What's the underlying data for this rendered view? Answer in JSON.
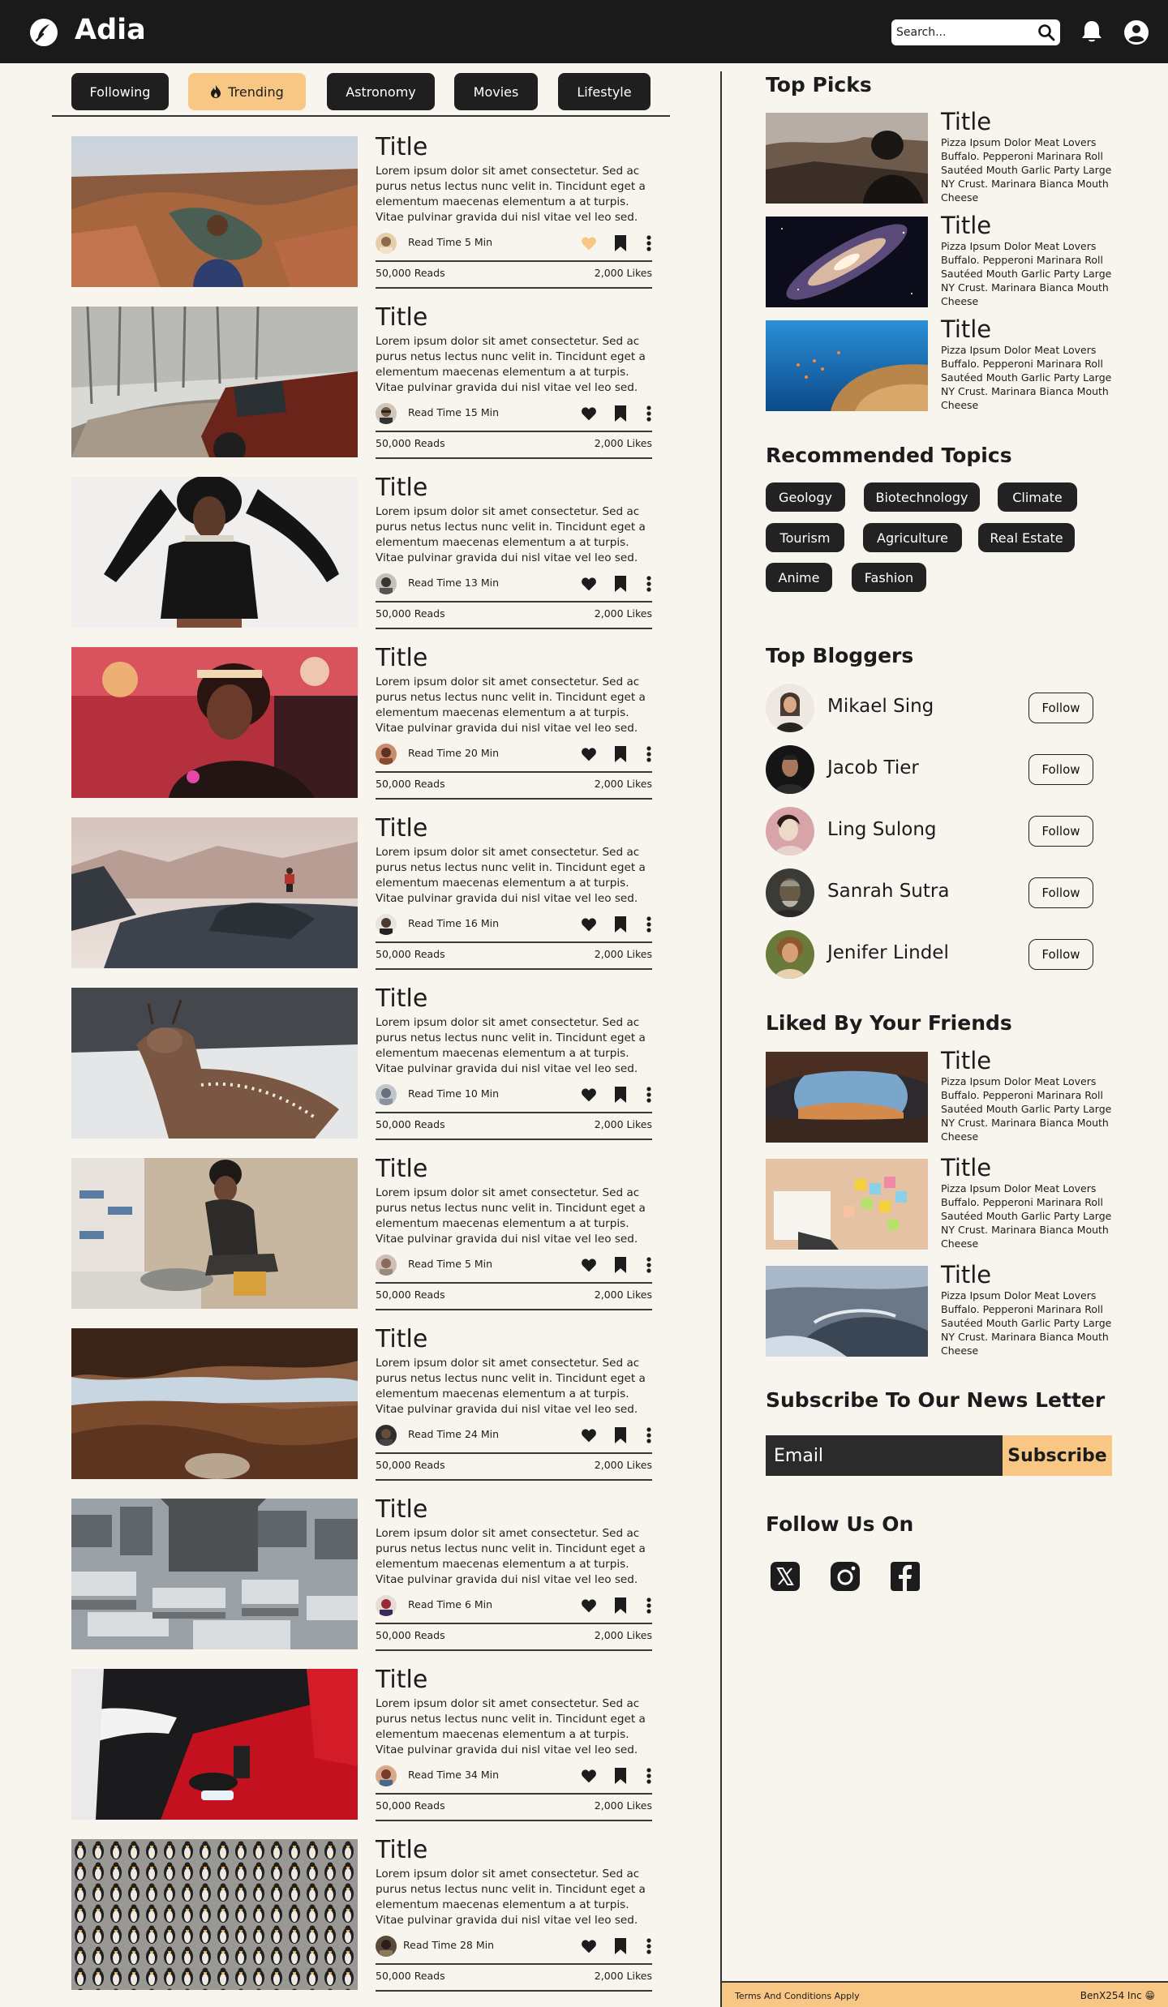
{
  "header": {
    "brand": "Adia",
    "search_placeholder": "Search...",
    "logo_icon": "feather-logo-icon",
    "search_icon": "search-icon",
    "bell_icon": "bell-icon",
    "user_icon": "user-circle-icon"
  },
  "tabs": [
    {
      "label": "Following",
      "active": false
    },
    {
      "label": "Trending",
      "active": true,
      "icon": "flame-icon"
    },
    {
      "label": "Astronomy",
      "active": false
    },
    {
      "label": "Movies",
      "active": false
    },
    {
      "label": "Lifestyle",
      "active": false
    }
  ],
  "posts": [
    {
      "title": "Title",
      "body": "Lorem ipsum dolor sit amet consectetur. Sed ac purus netus lectus nunc velit in. Tincidunt eget a elementum maecenas elementum a at turpis. Vitae pulvinar gravida dui nisl vitae vel leo sed.",
      "read_time": "Read Time 5 Min",
      "reads": "50,000 Reads",
      "likes": "2,000 Likes",
      "liked": true
    },
    {
      "title": "Title",
      "body": "Lorem ipsum dolor sit amet consectetur. Sed ac purus netus lectus nunc velit in. Tincidunt eget a elementum maecenas elementum a at turpis. Vitae pulvinar gravida dui nisl vitae vel leo sed.",
      "read_time": "Read Time 15 Min",
      "reads": "50,000 Reads",
      "likes": "2,000 Likes",
      "liked": false
    },
    {
      "title": "Title",
      "body": "Lorem ipsum dolor sit amet consectetur. Sed ac purus netus lectus nunc velit in. Tincidunt eget a elementum maecenas elementum a at turpis. Vitae pulvinar gravida dui nisl vitae vel leo sed.",
      "read_time": "Read Time 13 Min",
      "reads": "50,000 Reads",
      "likes": "2,000 Likes",
      "liked": false
    },
    {
      "title": "Title",
      "body": "Lorem ipsum dolor sit amet consectetur. Sed ac purus netus lectus nunc velit in. Tincidunt eget a elementum maecenas elementum a at turpis. Vitae pulvinar gravida dui nisl vitae vel leo sed.",
      "read_time": "Read Time 20 Min",
      "reads": "50,000 Reads",
      "likes": "2,000 Likes",
      "liked": false
    },
    {
      "title": "Title",
      "body": "Lorem ipsum dolor sit amet consectetur. Sed ac purus netus lectus nunc velit in. Tincidunt eget a elementum maecenas elementum a at turpis. Vitae pulvinar gravida dui nisl vitae vel leo sed.",
      "read_time": "Read Time 16 Min",
      "reads": "50,000 Reads",
      "likes": "2,000 Likes",
      "liked": false
    },
    {
      "title": "Title",
      "body": "Lorem ipsum dolor sit amet consectetur. Sed ac purus netus lectus nunc velit in. Tincidunt eget a elementum maecenas elementum a at turpis. Vitae pulvinar gravida dui nisl vitae vel leo sed.",
      "read_time": "Read Time 10 Min",
      "reads": "50,000 Reads",
      "likes": "2,000 Likes",
      "liked": false
    },
    {
      "title": "Title",
      "body": "Lorem ipsum dolor sit amet consectetur. Sed ac purus netus lectus nunc velit in. Tincidunt eget a elementum maecenas elementum a at turpis. Vitae pulvinar gravida dui nisl vitae vel leo sed.",
      "read_time": "Read Time 5 Min",
      "reads": "50,000 Reads",
      "likes": "2,000 Likes",
      "liked": false
    },
    {
      "title": "Title",
      "body": "Lorem ipsum dolor sit amet consectetur. Sed ac purus netus lectus nunc velit in. Tincidunt eget a elementum maecenas elementum a at turpis. Vitae pulvinar gravida dui nisl vitae vel leo sed.",
      "read_time": "Read Time 24 Min",
      "reads": "50,000 Reads",
      "likes": "2,000 Likes",
      "liked": false
    },
    {
      "title": "Title",
      "body": "Lorem ipsum dolor sit amet consectetur. Sed ac purus netus lectus nunc velit in. Tincidunt eget a elementum maecenas elementum a at turpis. Vitae pulvinar gravida dui nisl vitae vel leo sed.",
      "read_time": "Read Time 6 Min",
      "reads": "50,000 Reads",
      "likes": "2,000 Likes",
      "liked": false
    },
    {
      "title": "Title",
      "body": "Lorem ipsum dolor sit amet consectetur. Sed ac purus netus lectus nunc velit in. Tincidunt eget a elementum maecenas elementum a at turpis. Vitae pulvinar gravida dui nisl vitae vel leo sed.",
      "read_time": "Read Time 34 Min",
      "reads": "50,000 Reads",
      "likes": "2,000 Likes",
      "liked": false
    },
    {
      "title": "Title",
      "body": "Lorem ipsum dolor sit amet consectetur. Sed ac purus netus lectus nunc velit in. Tincidunt eget a elementum maecenas elementum a at turpis. Vitae pulvinar gravida dui nisl vitae vel leo sed.",
      "read_time": "Read Time 28 Min",
      "reads": "50,000 Reads",
      "likes": "2,000 Likes",
      "liked": false
    }
  ],
  "post_icons": {
    "like": "heart-icon",
    "save": "bookmark-icon",
    "more": "kebab-menu-icon"
  },
  "top_picks": {
    "heading": "Top Picks",
    "items": [
      {
        "title": "Title",
        "desc": "Pizza Ipsum Dolor Meat Lovers Buffalo. Pepperoni Marinara Roll Sautéed Mouth Garlic Party Large NY Crust. Marinara Bianca Mouth Cheese"
      },
      {
        "title": "Title",
        "desc": "Pizza Ipsum Dolor Meat Lovers Buffalo. Pepperoni Marinara Roll Sautéed Mouth Garlic Party Large NY Crust. Marinara Bianca Mouth Cheese"
      },
      {
        "title": "Title",
        "desc": "Pizza Ipsum Dolor Meat Lovers Buffalo. Pepperoni Marinara Roll Sautéed Mouth Garlic Party Large NY Crust. Marinara Bianca Mouth Cheese"
      }
    ]
  },
  "topics": {
    "heading": "Recommended Topics",
    "items": [
      "Geology",
      "Biotechnology",
      "Climate",
      "Tourism",
      "Agriculture",
      "Real Estate",
      "Anime",
      "Fashion"
    ]
  },
  "bloggers": {
    "heading": "Top Bloggers",
    "follow_label": "Follow",
    "items": [
      {
        "name": "Mikael Sing"
      },
      {
        "name": "Jacob Tier"
      },
      {
        "name": "Ling Sulong"
      },
      {
        "name": "Sanrah Sutra"
      },
      {
        "name": "Jenifer Lindel"
      }
    ]
  },
  "liked": {
    "heading": "Liked By Your Friends",
    "items": [
      {
        "title": "Title",
        "desc": "Pizza Ipsum Dolor Meat Lovers Buffalo. Pepperoni Marinara Roll Sautéed Mouth Garlic Party Large NY Crust. Marinara Bianca Mouth Cheese"
      },
      {
        "title": "Title",
        "desc": "Pizza Ipsum Dolor Meat Lovers Buffalo. Pepperoni Marinara Roll Sautéed Mouth Garlic Party Large NY Crust. Marinara Bianca Mouth Cheese"
      },
      {
        "title": "Title",
        "desc": "Pizza Ipsum Dolor Meat Lovers Buffalo. Pepperoni Marinara Roll Sautéed Mouth Garlic Party Large NY Crust. Marinara Bianca Mouth Cheese"
      }
    ]
  },
  "newsletter": {
    "heading": "Subscribe To Our News Letter",
    "placeholder": "Email",
    "button": "Subscribe"
  },
  "social": {
    "heading": "Follow Us On",
    "icons": [
      "x-twitter-icon",
      "instagram-icon",
      "facebook-icon"
    ]
  },
  "footer": {
    "terms": "Terms And Conditions Apply",
    "copyright": "BenX254 Inc 😁"
  },
  "colors": {
    "header_bg": "#1a1a1a",
    "page_bg": "#f8f5ef",
    "accent": "#f9c784",
    "chip_bg": "#222222"
  }
}
